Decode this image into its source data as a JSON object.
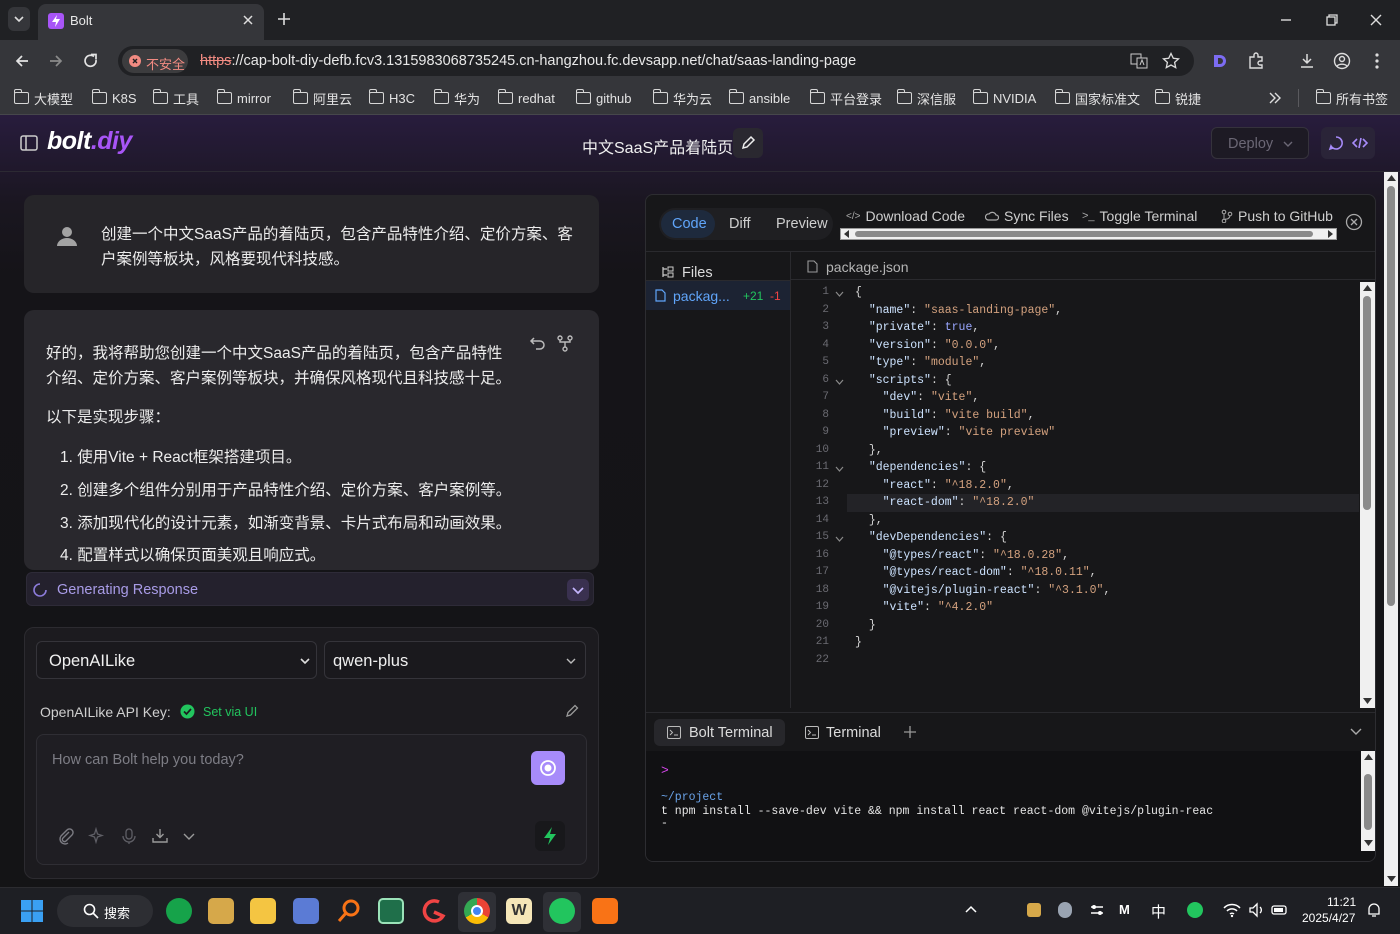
{
  "browser": {
    "tab_title": "Bolt",
    "security_label": "不安全",
    "url_scheme": "https",
    "url_rest": "://cap-bolt-diy-defb.fcv3.1315983068735245.cn-hangzhou.fc.devsapp.net/chat/saas-landing-page",
    "bookmarks": [
      "大模型",
      "K8S",
      "工具",
      "mirror",
      "阿里云",
      "H3C",
      "华为",
      "redhat",
      "github",
      "华为云",
      "ansible",
      "平台登录",
      "深信服",
      "NVIDIA",
      "国家标准文",
      "锐捷"
    ],
    "all_bookmarks": "所有书签"
  },
  "app": {
    "logo_main": "bolt",
    "logo_suffix": ".diy",
    "chat_title": "中文SaaS产品着陆页",
    "deploy_label": "Deploy"
  },
  "chat": {
    "user_message": "创建一个中文SaaS产品的着陆页，包含产品特性介绍、定价方案、客户案例等板块，风格要现代科技感。",
    "assistant_intro": "好的，我将帮助您创建一个中文SaaS产品的着陆页，包含产品特性介绍、定价方案、客户案例等板块，并确保风格现代且科技感十足。",
    "assistant_steps_heading": "以下是实现步骤：",
    "steps": [
      "1. 使用Vite + React框架搭建项目。",
      "2. 创建多个组件分别用于产品特性介绍、定价方案、客户案例等。",
      "3. 添加现代化的设计元素，如渐变背景、卡片式布局和动画效果。",
      "4. 配置样式以确保页面美观且响应式。"
    ],
    "generating_label": "Generating Response",
    "provider": "OpenAILike",
    "model": "qwen-plus",
    "api_key_label": "OpenAILike API Key:",
    "api_key_status": "Set via UI",
    "input_placeholder": "How can Bolt help you today?"
  },
  "workbench": {
    "tabs": [
      "Code",
      "Diff",
      "Preview"
    ],
    "actions": {
      "download": "Download Code",
      "sync": "Sync Files",
      "terminal": "Toggle Terminal",
      "github": "Push to GitHub"
    },
    "files_label": "Files",
    "file_item": "packag...",
    "file_diff_add": "+21",
    "file_diff_del": "-1",
    "open_file": "package.json",
    "code_lines": [
      "{",
      "  \"name\": \"saas-landing-page\",",
      "  \"private\": true,",
      "  \"version\": \"0.0.0\",",
      "  \"type\": \"module\",",
      "  \"scripts\": {",
      "    \"dev\": \"vite\",",
      "    \"build\": \"vite build\",",
      "    \"preview\": \"vite preview\"",
      "  },",
      "  \"dependencies\": {",
      "    \"react\": \"^18.2.0\",",
      "    \"react-dom\": \"^18.2.0\"",
      "  },",
      "  \"devDependencies\": {",
      "    \"@types/react\": \"^18.0.28\",",
      "    \"@types/react-dom\": \"^18.0.11\",",
      "    \"@vitejs/plugin-react\": \"^3.1.0\",",
      "    \"vite\": \"^4.2.0\"",
      "  }",
      "}",
      ""
    ],
    "terminal_tabs": [
      "Bolt Terminal",
      "Terminal"
    ],
    "terminal_lines": [
      ">",
      "",
      "~/project",
      "t npm install --save-dev vite && npm install react react-dom @vitejs/plugin-reac",
      "-"
    ]
  },
  "taskbar": {
    "search_label": "搜索",
    "ime": "中",
    "time": "11:21",
    "date": "2025/4/27"
  },
  "colors": {
    "accent": "#a78bfa",
    "tab_blue": "#60a5fa",
    "string": "#d4a27f",
    "key": "#cde3ff",
    "success": "#22c55e"
  }
}
